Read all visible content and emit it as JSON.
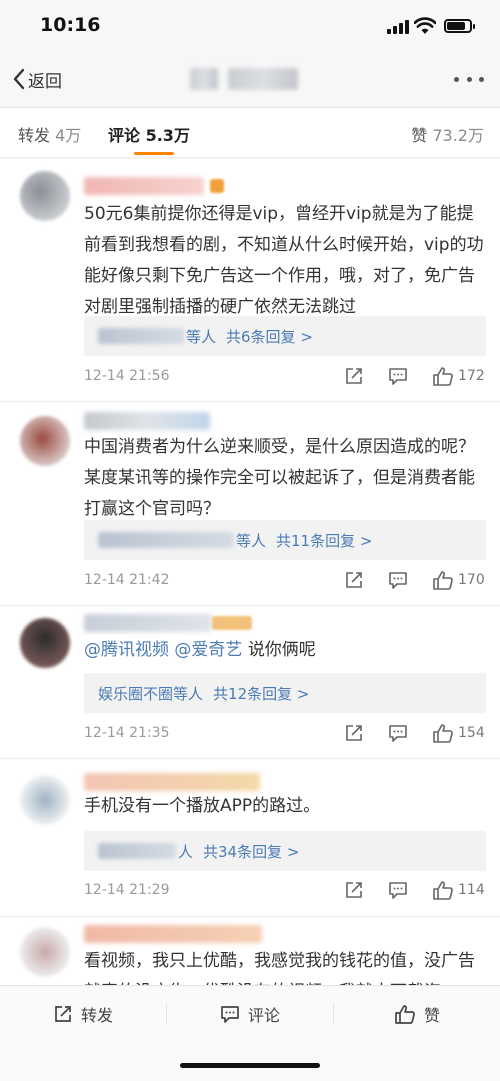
{
  "status": {
    "time": "10:16",
    "battery_level": 0.8
  },
  "nav": {
    "back_label": "返回"
  },
  "tabs": [
    {
      "label": "转发",
      "count": "4万"
    },
    {
      "label": "评论",
      "count": "5.3万"
    },
    {
      "label": "赞",
      "count": "73.2万"
    }
  ],
  "comments": [
    {
      "text": "50元6集前提你还得是vip，曾经开vip就是为了能提前看到我想看的剧，不知道从什么时候开始，vip的功能好像只剩下免广告这一个作用，哦，对了，免广告对剧里强制插播的硬广依然无法跳过",
      "reply_names": "",
      "reply_suffix": "等人",
      "reply_more": "共6条回复 >",
      "time": "12-14 21:56",
      "likes": "172"
    },
    {
      "text": "中国消费者为什么逆来顺受，是什么原因造成的呢？某度某讯等的操作完全可以被起诉了，但是消费者能打赢这个官司吗？",
      "reply_names": "",
      "reply_suffix": "等人",
      "reply_more": "共11条回复 >",
      "time": "12-14 21:42",
      "likes": "170"
    },
    {
      "mention1": "@腾讯视频",
      "mention2": "@爱奇艺",
      "text": "说你俩呢",
      "reply_names": "娱乐圈不圈",
      "reply_suffix": "等人",
      "reply_more": "共12条回复 >",
      "time": "12-14 21:35",
      "likes": "154"
    },
    {
      "text": "手机没有一个播放APP的路过。",
      "reply_names": "",
      "reply_suffix": "人",
      "reply_more": "共34条回复 >",
      "time": "12-14 21:29",
      "likes": "114"
    },
    {
      "text": "看视频，我只上优酷，我感觉我的钱花的值，没广告就真的没广告，优酷没有的视频，我就去下载盗"
    }
  ],
  "bottom_bar": {
    "repost": "转发",
    "comment": "评论",
    "like": "赞"
  },
  "colors": {
    "accent": "#ff8200",
    "link": "#4b7bb5"
  }
}
